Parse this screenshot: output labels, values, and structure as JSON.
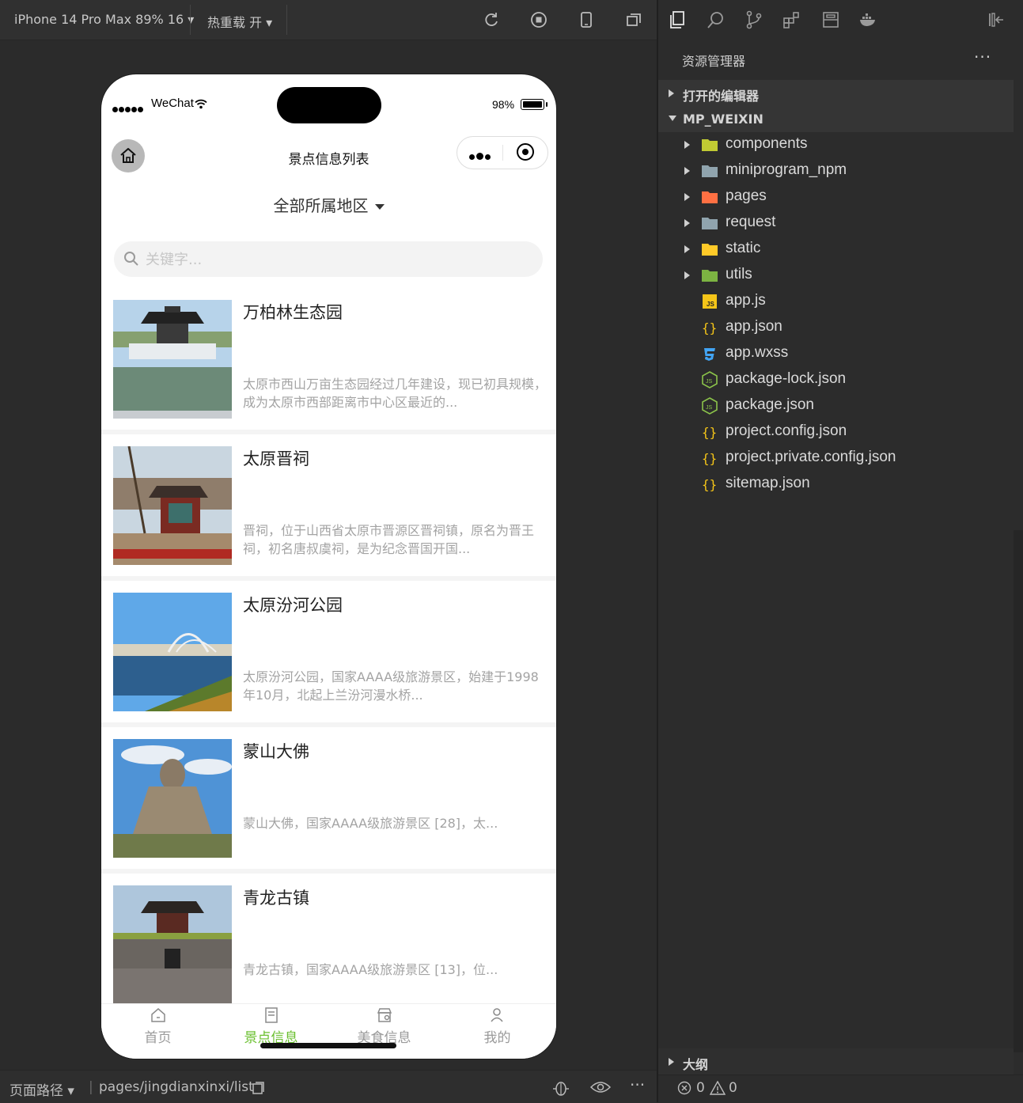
{
  "toolbar": {
    "device": "iPhone 14 Pro Max 89% 16",
    "hot_reload": "热重载 开"
  },
  "phone": {
    "status": {
      "carrier": "WeChat",
      "battery": "98%",
      "battery_level": 0.98
    },
    "nav_title": "景点信息列表",
    "region_filter": "全部所属地区",
    "search_placeholder": "关键字...",
    "items": [
      {
        "title": "万柏林生态园",
        "desc": "太原市西山万亩生态园经过几年建设，现已初具规模，成为太原市西部距离市中心区最近的..."
      },
      {
        "title": "太原晋祠",
        "desc": "晋祠，位于山西省太原市晋源区晋祠镇，原名为晋王祠，初名唐叔虞祠，是为纪念晋国开国..."
      },
      {
        "title": "太原汾河公园",
        "desc": "太原汾河公园，国家AAAA级旅游景区，始建于1998年10月，北起上兰汾河漫水桥..."
      },
      {
        "title": "蒙山大佛",
        "desc": "蒙山大佛，国家AAAA级旅游景区 [28]，太..."
      },
      {
        "title": "青龙古镇",
        "desc": "青龙古镇，国家AAAA级旅游景区 [13]，位..."
      }
    ],
    "tabs": [
      {
        "label": "首页",
        "icon": "home-icon",
        "active": false
      },
      {
        "label": "景点信息",
        "icon": "document-icon",
        "active": true
      },
      {
        "label": "美食信息",
        "icon": "shop-icon",
        "active": false
      },
      {
        "label": "我的",
        "icon": "user-icon",
        "active": false
      }
    ],
    "active_tab_color": "#6abf2e"
  },
  "bottom_bar": {
    "path_label": "页面路径",
    "path": "pages/jingdianxinxi/list"
  },
  "explorer": {
    "title": "资源管理器",
    "more": "···",
    "open_editors": "打开的编辑器",
    "project": "MP_WEIXIN",
    "tree": [
      {
        "name": "components",
        "type": "folder",
        "color": "#c0ca33"
      },
      {
        "name": "miniprogram_npm",
        "type": "folder",
        "color": "#90a4ae"
      },
      {
        "name": "pages",
        "type": "folder",
        "color": "#ff7043"
      },
      {
        "name": "request",
        "type": "folder",
        "color": "#90a4ae"
      },
      {
        "name": "static",
        "type": "folder",
        "color": "#ffca28"
      },
      {
        "name": "utils",
        "type": "folder",
        "color": "#7cb342"
      },
      {
        "name": "app.js",
        "type": "js",
        "color": "#f5c518"
      },
      {
        "name": "app.json",
        "type": "json",
        "color": "#f5c518"
      },
      {
        "name": "app.wxss",
        "type": "css",
        "color": "#42a5f5"
      },
      {
        "name": "package-lock.json",
        "type": "node",
        "color": "#8bc34a"
      },
      {
        "name": "package.json",
        "type": "node",
        "color": "#8bc34a"
      },
      {
        "name": "project.config.json",
        "type": "json",
        "color": "#f5c518"
      },
      {
        "name": "project.private.config.json",
        "type": "json",
        "color": "#f5c518"
      },
      {
        "name": "sitemap.json",
        "type": "json",
        "color": "#f5c518"
      }
    ],
    "outline": "大纲",
    "errors": "0",
    "warnings": "0"
  }
}
